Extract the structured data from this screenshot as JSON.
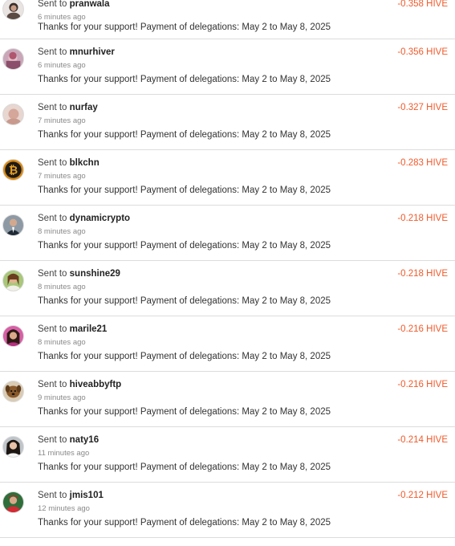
{
  "accent_color": "#f05a2b",
  "transactions": [
    {
      "prefix": "Sent to",
      "user": "pranwala",
      "time": "6 minutes ago",
      "memo": "Thanks for your support! Payment of delegations: May 2 to May 8, 2025",
      "amount": "-0.358 HIVE",
      "avatar": "avatar-pranwala"
    },
    {
      "prefix": "Sent to",
      "user": "mnurhiver",
      "time": "6 minutes ago",
      "memo": "Thanks for your support! Payment of delegations: May 2 to May 8, 2025",
      "amount": "-0.356 HIVE",
      "avatar": "avatar-mnurhiver"
    },
    {
      "prefix": "Sent to",
      "user": "nurfay",
      "time": "7 minutes ago",
      "memo": "Thanks for your support! Payment of delegations: May 2 to May 8, 2025",
      "amount": "-0.327 HIVE",
      "avatar": "avatar-nurfay"
    },
    {
      "prefix": "Sent to",
      "user": "blkchn",
      "time": "7 minutes ago",
      "memo": "Thanks for your support! Payment of delegations: May 2 to May 8, 2025",
      "amount": "-0.283 HIVE",
      "avatar": "bitcoin-icon"
    },
    {
      "prefix": "Sent to",
      "user": "dynamicrypto",
      "time": "8 minutes ago",
      "memo": "Thanks for your support! Payment of delegations: May 2 to May 8, 2025",
      "amount": "-0.218 HIVE",
      "avatar": "avatar-dynamicrypto"
    },
    {
      "prefix": "Sent to",
      "user": "sunshine29",
      "time": "8 minutes ago",
      "memo": "Thanks for your support! Payment of delegations: May 2 to May 8, 2025",
      "amount": "-0.218 HIVE",
      "avatar": "avatar-sunshine29"
    },
    {
      "prefix": "Sent to",
      "user": "marile21",
      "time": "8 minutes ago",
      "memo": "Thanks for your support! Payment of delegations: May 2 to May 8, 2025",
      "amount": "-0.216 HIVE",
      "avatar": "avatar-marile21"
    },
    {
      "prefix": "Sent to",
      "user": "hiveabbyftp",
      "time": "9 minutes ago",
      "memo": "Thanks for your support! Payment of delegations: May 2 to May 8, 2025",
      "amount": "-0.216 HIVE",
      "avatar": "avatar-hiveabbyftp"
    },
    {
      "prefix": "Sent to",
      "user": "naty16",
      "time": "11 minutes ago",
      "memo": "Thanks for your support! Payment of delegations: May 2 to May 8, 2025",
      "amount": "-0.214 HIVE",
      "avatar": "avatar-naty16"
    },
    {
      "prefix": "Sent to",
      "user": "jmis101",
      "time": "12 minutes ago",
      "memo": "Thanks for your support! Payment of delegations: May 2 to May 8, 2025",
      "amount": "-0.212 HIVE",
      "avatar": "avatar-jmis101"
    }
  ]
}
